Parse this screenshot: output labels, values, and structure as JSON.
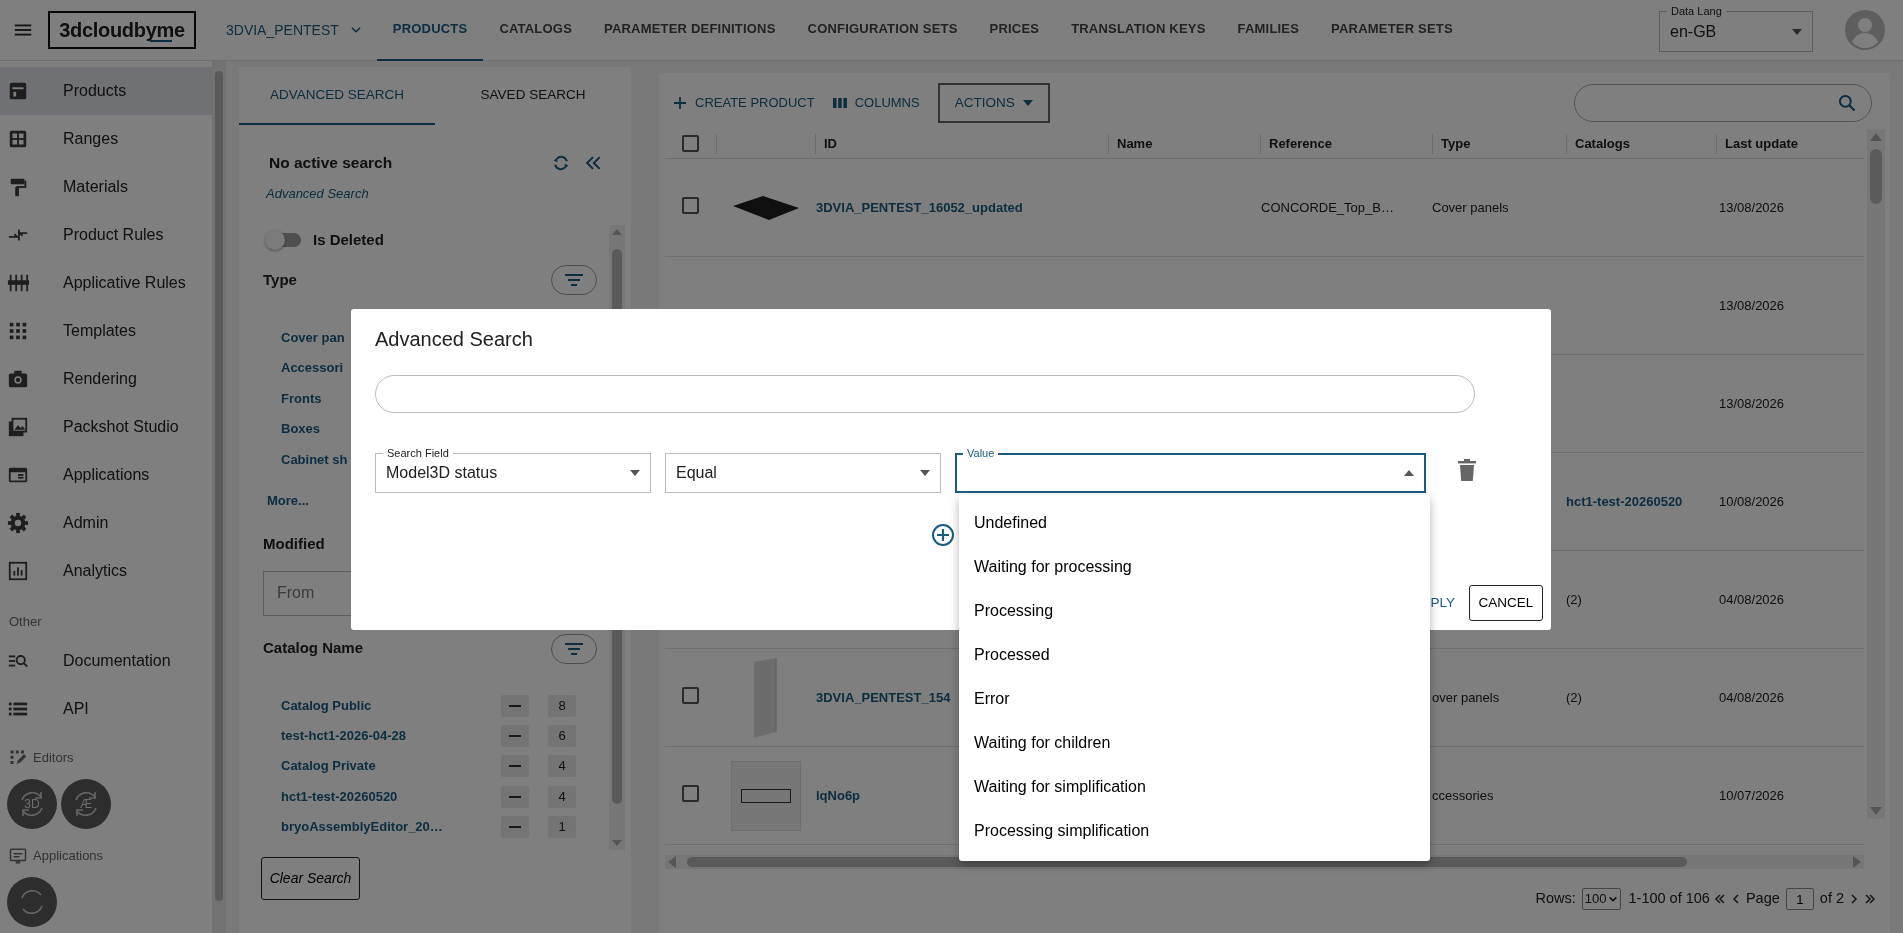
{
  "top_bar": {
    "logo": "3dcloudbyme",
    "project": "3DVIA_PENTEST",
    "tabs": [
      {
        "label": "PRODUCTS",
        "selected": true
      },
      {
        "label": "CATALOGS",
        "selected": false
      },
      {
        "label": "PARAMETER DEFINITIONS",
        "selected": false
      },
      {
        "label": "CONFIGURATION SETS",
        "selected": false
      },
      {
        "label": "PRICES",
        "selected": false
      },
      {
        "label": "TRANSLATION KEYS",
        "selected": false
      },
      {
        "label": "FAMILIES",
        "selected": false
      },
      {
        "label": "PARAMETER SETS",
        "selected": false
      }
    ],
    "data_lang": {
      "label": "Data Lang",
      "value": "en-GB"
    }
  },
  "sidebar": {
    "items": [
      {
        "label": "Products",
        "selected": true
      },
      {
        "label": "Ranges",
        "selected": false
      },
      {
        "label": "Materials",
        "selected": false
      },
      {
        "label": "Product Rules",
        "selected": false
      },
      {
        "label": "Applicative Rules",
        "selected": false
      },
      {
        "label": "Templates",
        "selected": false
      },
      {
        "label": "Rendering",
        "selected": false
      },
      {
        "label": "Packshot Studio",
        "selected": false
      },
      {
        "label": "Applications",
        "selected": false
      },
      {
        "label": "Admin",
        "selected": false
      },
      {
        "label": "Analytics",
        "selected": false
      }
    ],
    "other_heading": "Other",
    "other_items": [
      {
        "label": "Documentation",
        "selected": false
      },
      {
        "label": "API",
        "selected": false
      }
    ],
    "editors_heading": "Editors",
    "editors": [
      "3D",
      "Æ"
    ],
    "applications_heading": "Applications"
  },
  "filter_panel": {
    "tabs": [
      {
        "label": "ADVANCED SEARCH",
        "selected": true
      },
      {
        "label": "SAVED SEARCH",
        "selected": false
      }
    ],
    "status": "No active search",
    "status_link": "Advanced Search",
    "is_deleted": {
      "label": "Is Deleted",
      "on": false
    },
    "type": {
      "title": "Type",
      "items": [
        "Cover pan",
        "Accessori",
        "Fronts",
        "Boxes",
        "Cabinet sh"
      ],
      "more": "More..."
    },
    "modified": {
      "title": "Modified",
      "from_placeholder": "From"
    },
    "catalog_name": {
      "title": "Catalog Name",
      "items": [
        {
          "name": "Catalog Public",
          "count": "8"
        },
        {
          "name": "test-hct1-2026-04-28",
          "count": "6"
        },
        {
          "name": "Catalog Private",
          "count": "4"
        },
        {
          "name": "hct1-test-20260520",
          "count": "4"
        },
        {
          "name": "bryoAssemblyEditor_20…",
          "count": "1"
        }
      ]
    },
    "clear_button": "Clear Search"
  },
  "toolbar": {
    "create": "CREATE PRODUCT",
    "columns": "COLUMNS",
    "actions": "ACTIONS"
  },
  "table": {
    "select_all_selected": false,
    "columns": [
      "ID",
      "Name",
      "Reference",
      "Type",
      "Catalogs",
      "Last update"
    ],
    "rows": [
      {
        "kind": "product",
        "selected": false,
        "id": "3DVIA_PENTEST_16052_updated",
        "reference": "CONCORDE_Top_B…",
        "type": "Cover panels",
        "last_update": "13/08/2026"
      },
      {
        "kind": "covered",
        "last_update": "13/08/2026"
      },
      {
        "kind": "covered",
        "last_update": "13/08/2026"
      },
      {
        "kind": "covered",
        "catalogs": {
          "text": "hct1-test-20260520",
          "kind": "link"
        },
        "last_update": "10/08/2026"
      },
      {
        "kind": "covered",
        "catalogs": {
          "text": "(2)",
          "kind": "count"
        },
        "last_update": "04/08/2026"
      },
      {
        "kind": "product",
        "selected": false,
        "id": "3DVIA_PENTEST_154",
        "type": "over panels",
        "catalogs": {
          "text": "(2)",
          "kind": "count"
        },
        "last_update": "04/08/2026"
      },
      {
        "kind": "product",
        "selected": false,
        "id": "lqNo6p",
        "type": "ccessories",
        "last_update": "10/07/2026"
      }
    ]
  },
  "pagination": {
    "rows_label": "Rows:",
    "rows_value": "100",
    "range": "1-100 of 106",
    "page_label": "Page",
    "page": "1",
    "page_count": "of 2"
  },
  "dialog": {
    "title": "Advanced Search",
    "fields": [
      {
        "label": "Search Field",
        "value": "Model3D status",
        "focused": false,
        "expanded": false
      },
      {
        "value": "Equal",
        "focused": false,
        "expanded": false
      },
      {
        "label": "Value",
        "focused": true,
        "expanded": true
      }
    ],
    "options": [
      {
        "label": "Undefined",
        "selected": false
      },
      {
        "label": "Waiting for processing",
        "selected": false
      },
      {
        "label": "Processing",
        "selected": false
      },
      {
        "label": "Processed",
        "selected": false
      },
      {
        "label": "Error",
        "selected": false
      },
      {
        "label": "Waiting for children",
        "selected": false
      },
      {
        "label": "Waiting for simplification",
        "selected": false
      },
      {
        "label": "Processing simplification",
        "selected": false
      }
    ],
    "apply": "PLY",
    "cancel": "CANCEL"
  }
}
